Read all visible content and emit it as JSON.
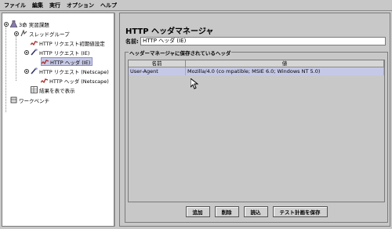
{
  "menu": [
    "ファイル",
    "編集",
    "実行",
    "オプション",
    "ヘルプ"
  ],
  "tree": {
    "plan": "3命 実習課題",
    "thread_group": "スレッドグループ",
    "http_defaults": "HTTP リクエスト初期値設定",
    "http_request_ie": "HTTP リクエスト (IE)",
    "http_header_ie": "HTTP ヘッダ (IE)",
    "http_request_netscape": "HTTP リクエスト (Netscape)",
    "http_header_netscape": "HTTP ヘッダ (Netscape)",
    "results_table": "結果を表で表示",
    "workbench": "ワークベンチ"
  },
  "panel": {
    "title": "HTTP ヘッダマネージャ",
    "name_label": "名前:",
    "name_value": "HTTP ヘッダ (IE)",
    "group_title": "ヘッダーマネージャに保存されているヘッダ",
    "columns": [
      "名前",
      "値"
    ],
    "rows": [
      {
        "name": "User-Agent",
        "value": "Mozilla/4.0 (co mpatible; MSIE 6.0; Windows NT 5.0)"
      }
    ]
  },
  "buttons": {
    "add": "追加",
    "delete": "削除",
    "load": "読込",
    "save": "テスト計画を保存"
  }
}
